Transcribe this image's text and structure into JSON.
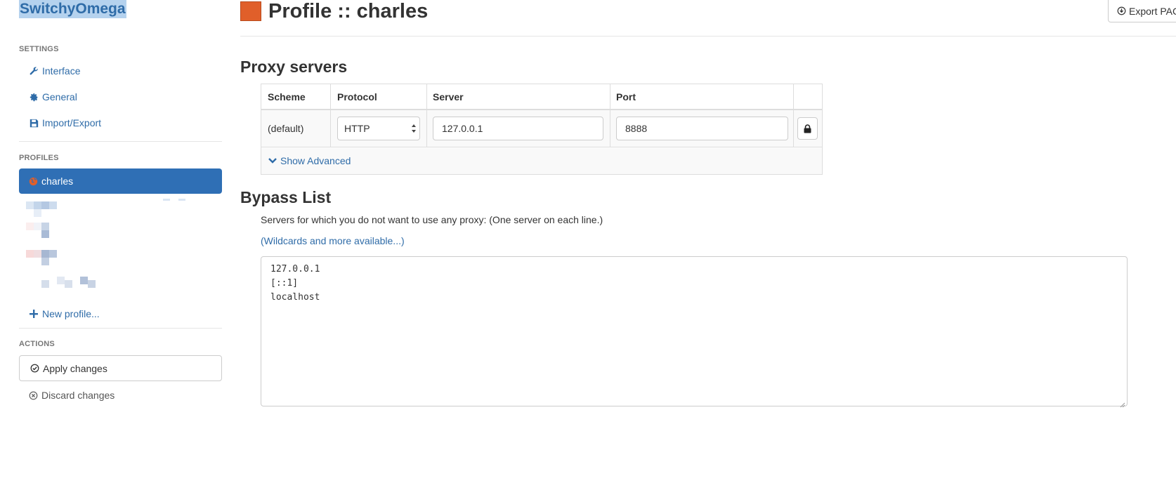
{
  "sidebar": {
    "brand": "SwitchyOmega",
    "settings_header": "SETTINGS",
    "settings_items": [
      {
        "label": "Interface",
        "icon": "wrench-icon"
      },
      {
        "label": "General",
        "icon": "gear-icon"
      },
      {
        "label": "Import/Export",
        "icon": "floppy-disk-icon"
      }
    ],
    "profiles_header": "PROFILES",
    "active_profile": {
      "label": "charles",
      "icon": "globe-icon"
    },
    "new_profile_label": "New profile...",
    "actions_header": "ACTIONS",
    "apply_label": "Apply changes",
    "discard_label": "Discard changes"
  },
  "header": {
    "title": "Profile :: charles",
    "profile_color": "#e05f2a",
    "export_label": "Export PAC"
  },
  "proxy": {
    "section_title": "Proxy servers",
    "columns": {
      "scheme": "Scheme",
      "protocol": "Protocol",
      "server": "Server",
      "port": "Port"
    },
    "row": {
      "scheme": "(default)",
      "protocol": "HTTP",
      "server": "127.0.0.1",
      "port": "8888"
    },
    "show_advanced": "Show Advanced"
  },
  "bypass": {
    "section_title": "Bypass List",
    "description": "Servers for which you do not want to use any proxy: (One server on each line.)",
    "link": "(Wildcards and more available...)",
    "entries": "127.0.0.1\n[::1]\nlocalhost"
  },
  "colors": {
    "link": "#2f6ca8",
    "active_bg": "#2f6fb5",
    "brand_highlight": "#b5d2ee"
  }
}
